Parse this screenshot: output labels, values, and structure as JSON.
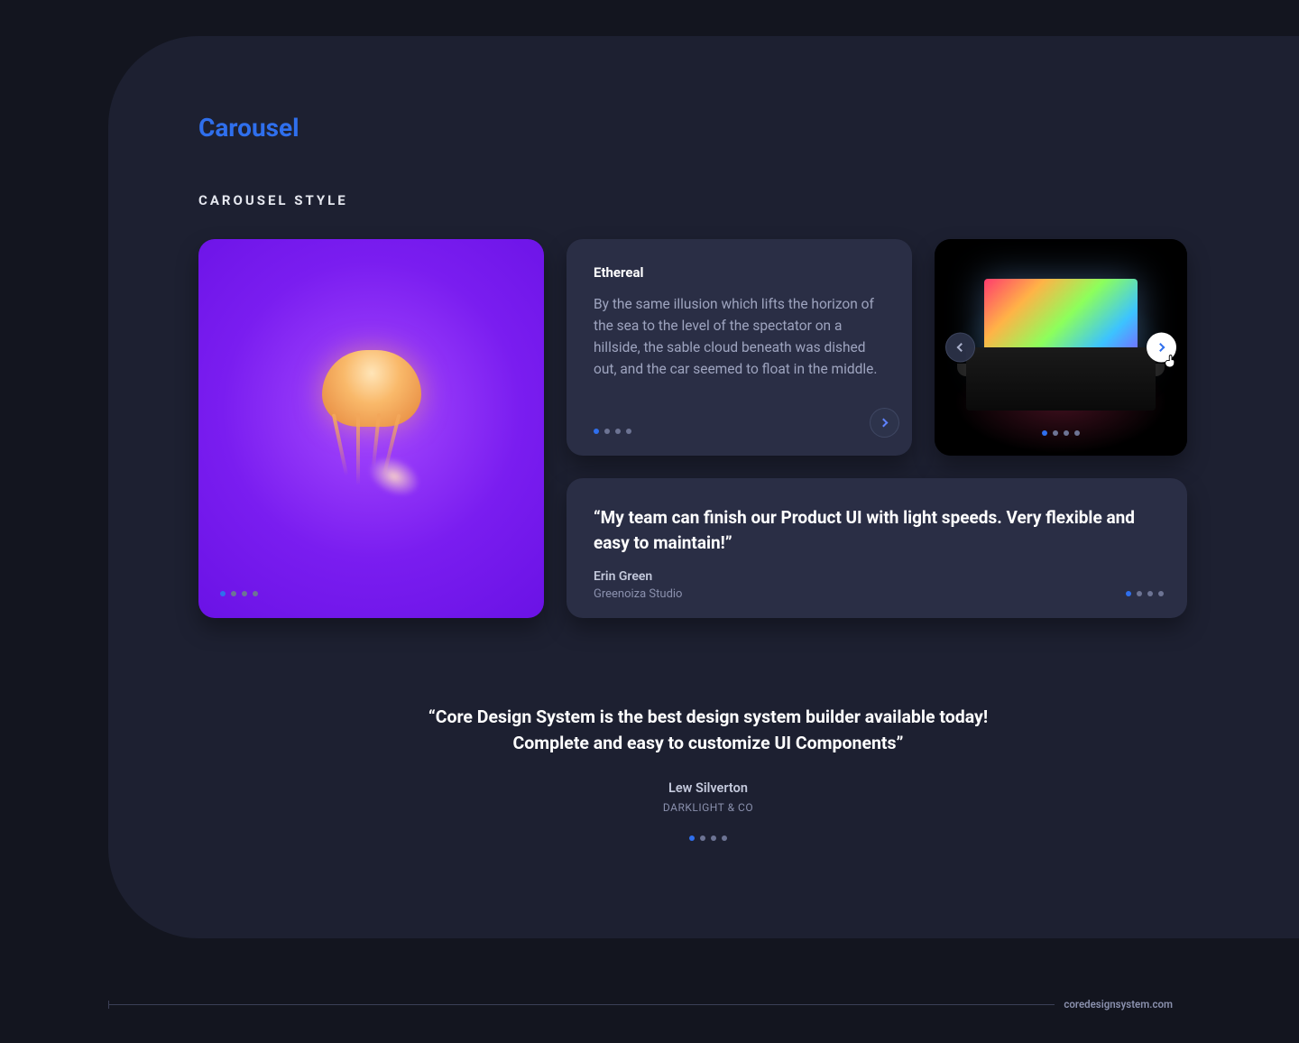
{
  "page": {
    "title": "Carousel",
    "subtitle": "CAROUSEL STYLE"
  },
  "text_card": {
    "heading": "Ethereal",
    "body": "By the same illusion which lifts the horizon of the sea to the level of the spectator on a hillside, the sable cloud beneath was dished out, and the car seemed to float in the middle."
  },
  "quote_card": {
    "quote": "“My team can finish our Product UI with light speeds. Very flexible and easy to maintain!”",
    "author": "Erin Green",
    "org": "Greenoiza Studio"
  },
  "center_quote": {
    "line1": "“Core Design System is the best design system builder available today!",
    "line2": "Complete and easy to customize UI Components”",
    "author": "Lew Silverton",
    "org": "DARKLIGHT & CO"
  },
  "footer": {
    "link": "coredesignsystem.com"
  },
  "colors": {
    "accent": "#2f6fed",
    "panel": "#1d2031",
    "card": "#2a2e45"
  },
  "dot_count": 4
}
